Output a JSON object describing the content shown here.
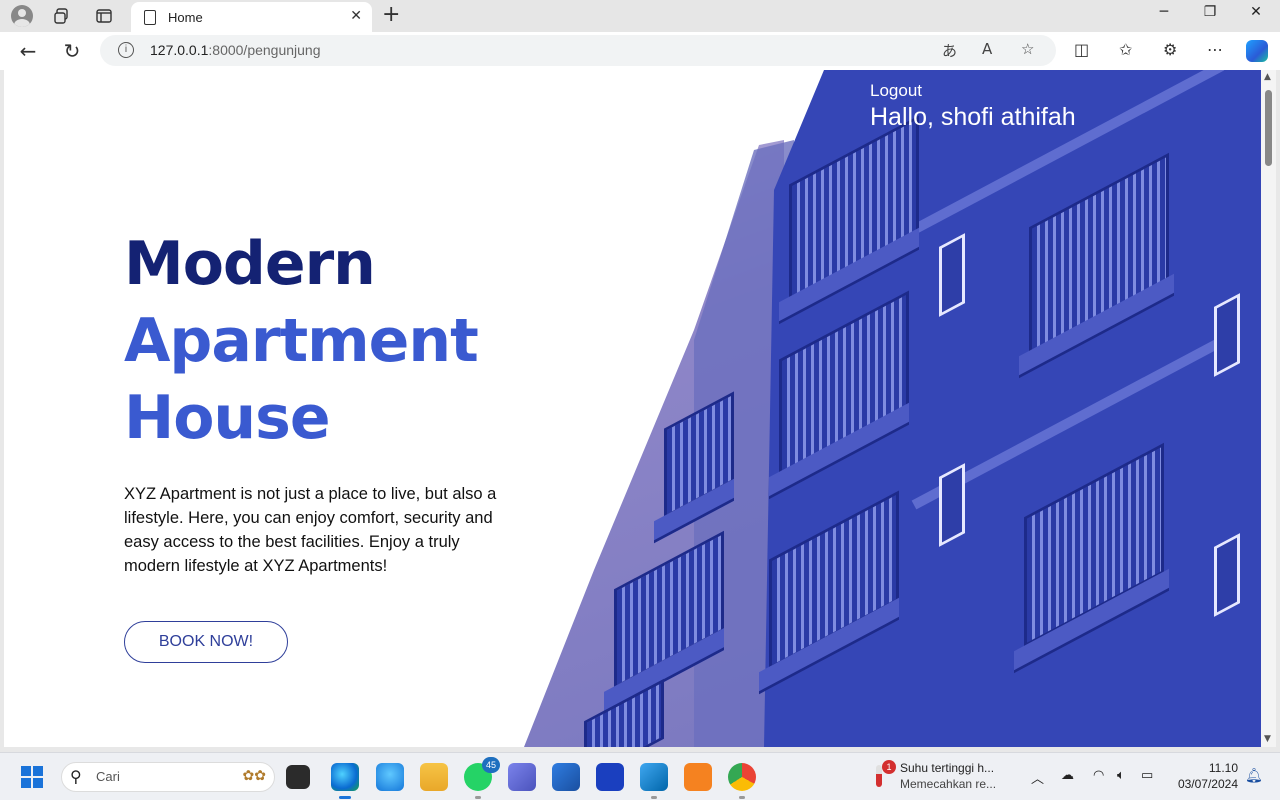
{
  "browser": {
    "tab_title": "Home",
    "tab_close": "✕",
    "new_tab": "+",
    "window_controls": {
      "minimize": "─",
      "restore": "❐",
      "close": "✕"
    },
    "url_host": "127.0.0.1",
    "url_path": ":8000/pengunjung",
    "icons": [
      "profile-icon",
      "workspaces-icon",
      "tab-actions-icon",
      "back-icon",
      "refresh-icon",
      "site-info-icon",
      "translate-icon",
      "read-aloud-icon",
      "favorite-star-icon",
      "split-screen-icon",
      "favorites-icon",
      "extensions-icon",
      "more-icon",
      "copilot-icon"
    ]
  },
  "page": {
    "logout_label": "Logout",
    "greeting": "Hallo, shofi athifah",
    "headline": [
      "Modern",
      "Apartment",
      "House"
    ],
    "description": "XYZ Apartment is not just a place to live, but also a lifestyle. Here, you can enjoy comfort, security and easy access to the best facilities. Enjoy a truly modern lifestyle at XYZ Apartments!",
    "cta_label": "BOOK NOW!",
    "colors": {
      "headline_dark": "#142273",
      "headline_accent": "#3a5ad0",
      "hero_overlay": "#3546b6"
    }
  },
  "taskbar": {
    "search_placeholder": "Cari",
    "apps": [
      "file-explorer-icon",
      "edge-icon",
      "store-icon",
      "folder-icon",
      "whatsapp-icon",
      "teams-icon",
      "microsoft-store-icon",
      "azure-icon",
      "vscode-icon",
      "xampp-icon",
      "chrome-icon"
    ],
    "whatsapp_badge": "45",
    "weather_badge": "1",
    "weather_title": "Suhu tertinggi h...",
    "weather_sub": "Memecahkan re...",
    "time": "11.10",
    "date": "03/07/2024"
  }
}
